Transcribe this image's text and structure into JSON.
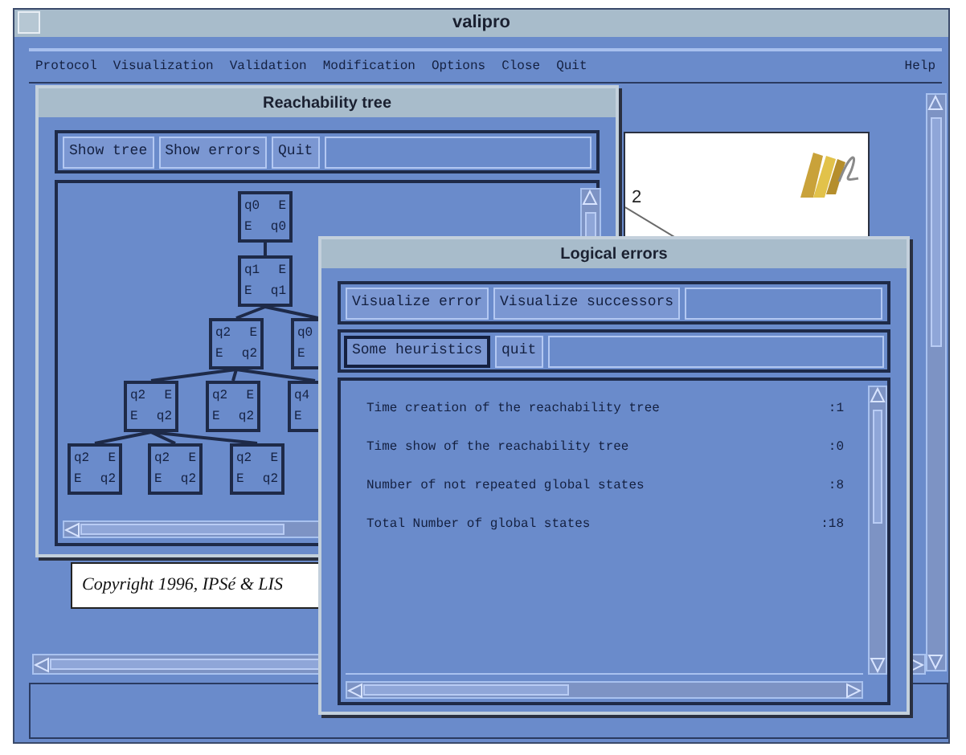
{
  "window": {
    "title": "valipro"
  },
  "menu": [
    {
      "label": "Protocol"
    },
    {
      "label": "Visualization"
    },
    {
      "label": "Validation"
    },
    {
      "label": "Modification"
    },
    {
      "label": "Options"
    },
    {
      "label": "Close"
    },
    {
      "label": "Quit"
    }
  ],
  "help_menu": {
    "label": "Help"
  },
  "canvas": {
    "node_label": "2"
  },
  "copyright": "Copyright 1996, IPSé & LIS",
  "reachability_window": {
    "title": "Reachability tree",
    "buttons": [
      "Show tree",
      "Show errors",
      "Quit"
    ],
    "tree": {
      "top_left": "q0",
      "top_right": "E",
      "bottom_left": "E",
      "bottom_right": "q0",
      "children": [
        {
          "top_left": "q1",
          "top_right": "E",
          "bottom_left": "E",
          "bottom_right": "q1",
          "children": [
            {
              "top_left": "q2",
              "top_right": "E",
              "bottom_left": "E",
              "bottom_right": "q2",
              "children": [
                {
                  "top_left": "q2",
                  "top_right": "E",
                  "bottom_left": "E",
                  "bottom_right": "q2",
                  "children": [
                    {
                      "top_left": "q2",
                      "top_right": "E",
                      "bottom_left": "E",
                      "bottom_right": "q2"
                    },
                    {
                      "top_left": "q2",
                      "top_right": "E",
                      "bottom_left": "E",
                      "bottom_right": "q2"
                    },
                    {
                      "top_left": "q2",
                      "top_right": "E",
                      "bottom_left": "E",
                      "bottom_right": "q2"
                    }
                  ]
                },
                {
                  "top_left": "q2",
                  "top_right": "E",
                  "bottom_left": "E",
                  "bottom_right": "q2"
                },
                {
                  "top_left": "q4",
                  "bottom_left": "E"
                }
              ]
            },
            {
              "top_left": "q0",
              "bottom_left": "E"
            }
          ]
        }
      ]
    }
  },
  "errors_window": {
    "title": "Logical errors",
    "buttons_row_1": [
      {
        "label": "Visualize error",
        "selected": false
      },
      {
        "label": "Visualize successors",
        "selected": false
      }
    ],
    "buttons_row_2": [
      {
        "label": "Some heuristics",
        "selected": true
      },
      {
        "label": "quit",
        "selected": false
      }
    ],
    "rows": [
      {
        "label": "Time creation of the reachability tree",
        "value": ":1"
      },
      {
        "label": "Time show of the reachability tree",
        "value": ":0"
      },
      {
        "label": "Number of not repeated global states",
        "value": ":8"
      },
      {
        "label": "Total Number of global states",
        "value": ":18"
      }
    ]
  }
}
